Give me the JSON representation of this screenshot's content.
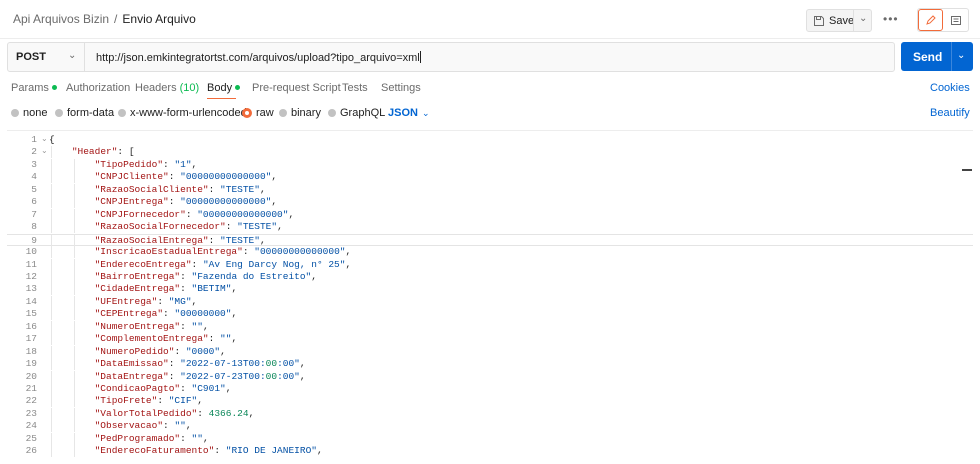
{
  "breadcrumb": {
    "parent": "Api Arquivos Bizin",
    "separator": "/",
    "current": "Envio Arquivo"
  },
  "toolbar": {
    "save_label": "Save",
    "more": "•••"
  },
  "request": {
    "method": "POST",
    "url": "http://json.emkintegratortst.com/arquivos/upload?tipo_arquivo=xml",
    "send_label": "Send"
  },
  "tabs": {
    "params": "Params",
    "authorization": "Authorization",
    "headers": "Headers",
    "headers_count": "(10)",
    "body": "Body",
    "prerequest": "Pre-request Script",
    "tests": "Tests",
    "settings": "Settings",
    "cookies": "Cookies"
  },
  "body_options": {
    "none": "none",
    "form_data": "form-data",
    "urlencoded": "x-www-form-urlencoded",
    "raw": "raw",
    "binary": "binary",
    "graphql": "GraphQL",
    "format": "JSON",
    "beautify": "Beautify",
    "selected": "raw"
  },
  "editor": {
    "lines": [
      {
        "n": "1",
        "text": "{"
      },
      {
        "n": "2",
        "text": "    \"Header\": ["
      },
      {
        "n": "3",
        "text": "        \"TipoPedido\": \"1\","
      },
      {
        "n": "4",
        "text": "        \"CNPJCliente\": \"00000000000000\","
      },
      {
        "n": "5",
        "text": "        \"RazaoSocialCliente\": \"TESTE\","
      },
      {
        "n": "6",
        "text": "        \"CNPJEntrega\": \"00000000000000\","
      },
      {
        "n": "7",
        "text": "        \"CNPJFornecedor\": \"00000000000000\","
      },
      {
        "n": "8",
        "text": "        \"RazaoSocialFornecedor\": \"TESTE\","
      },
      {
        "n": "9",
        "text": "        \"RazaoSocialEntrega\": \"TESTE\","
      },
      {
        "n": "10",
        "text": "        \"InscricaoEstadualEntrega\": \"00000000000000\","
      },
      {
        "n": "11",
        "text": "        \"EnderecoEntrega\": \"Av Eng Darcy Nog, n° 25\","
      },
      {
        "n": "12",
        "text": "        \"BairroEntrega\": \"Fazenda do Estreito\","
      },
      {
        "n": "13",
        "text": "        \"CidadeEntrega\": \"BETIM\","
      },
      {
        "n": "14",
        "text": "        \"UFEntrega\": \"MG\","
      },
      {
        "n": "15",
        "text": "        \"CEPEntrega\": \"00000000\","
      },
      {
        "n": "16",
        "text": "        \"NumeroEntrega\": \"\","
      },
      {
        "n": "17",
        "text": "        \"ComplementoEntrega\": \"\","
      },
      {
        "n": "18",
        "text": "        \"NumeroPedido\": \"0000\","
      },
      {
        "n": "19",
        "text": "        \"DataEmissao\": \"2022-07-13T00:00:00\","
      },
      {
        "n": "20",
        "text": "        \"DataEntrega\": \"2022-07-23T00:00:00\","
      },
      {
        "n": "21",
        "text": "        \"CondicaoPagto\": \"C901\","
      },
      {
        "n": "22",
        "text": "        \"TipoFrete\": \"CIF\","
      },
      {
        "n": "23",
        "text": "        \"ValorTotalPedido\": 4366.24,"
      },
      {
        "n": "24",
        "text": "        \"Observacao\": \"\","
      },
      {
        "n": "25",
        "text": "        \"PedProgramado\": \"\","
      },
      {
        "n": "26",
        "text": "        \"EnderecoFaturamento\": \"RIO DE JANEIRO\","
      }
    ]
  },
  "colors": {
    "accent": "#f26b3a",
    "primary": "#0265d2",
    "status_dot": "#0cbb52"
  },
  "icons": {
    "save": "save-icon",
    "edit": "pencil-icon",
    "comments": "comment-icon"
  }
}
